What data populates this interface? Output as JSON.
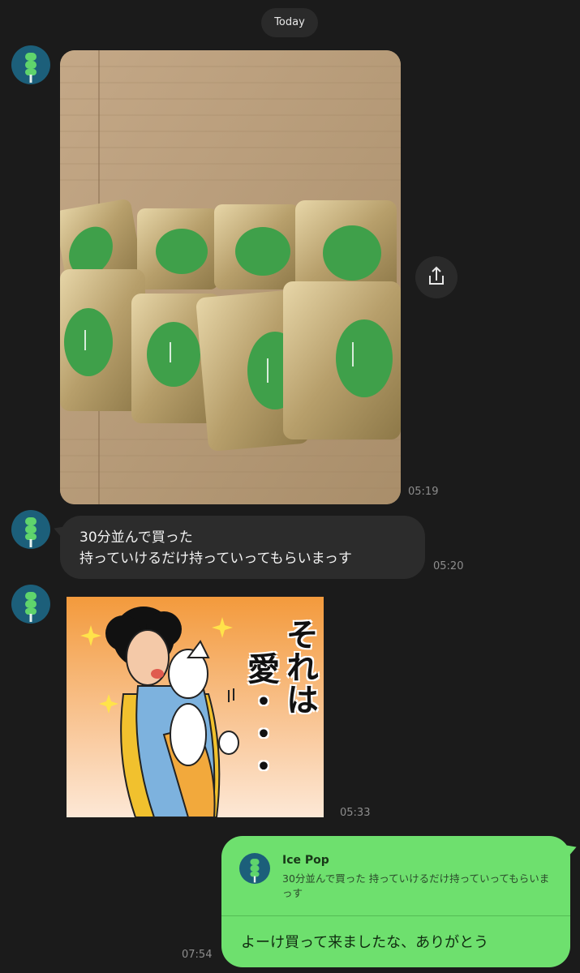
{
  "date_separator": "Today",
  "sender": {
    "avatar_icon": "green-bug-icon",
    "avatar_bg": "#1c5f7a"
  },
  "messages": [
    {
      "type": "photo",
      "time": "05:19",
      "share_icon": "share-icon"
    },
    {
      "type": "text",
      "lines": [
        "30分並んで買った",
        "持っていけるだけ持っていってもらいまっす"
      ],
      "time": "05:20"
    },
    {
      "type": "sticker",
      "time": "05:33",
      "sticker_text": [
        "それは",
        "愛・・・"
      ]
    },
    {
      "type": "reply",
      "time": "07:54",
      "quote_name": "Ice Pop",
      "quote_text": "30分並んで買った 持っていけるだけ持っていってもらいまっす",
      "body": "よーけ買って来ましたな、ありがとう"
    }
  ],
  "colors": {
    "background": "#1b1b1b",
    "incoming_bubble": "#2c2c2c",
    "outgoing_bubble": "#6ee06e",
    "timestamp": "#8d8d8d"
  }
}
